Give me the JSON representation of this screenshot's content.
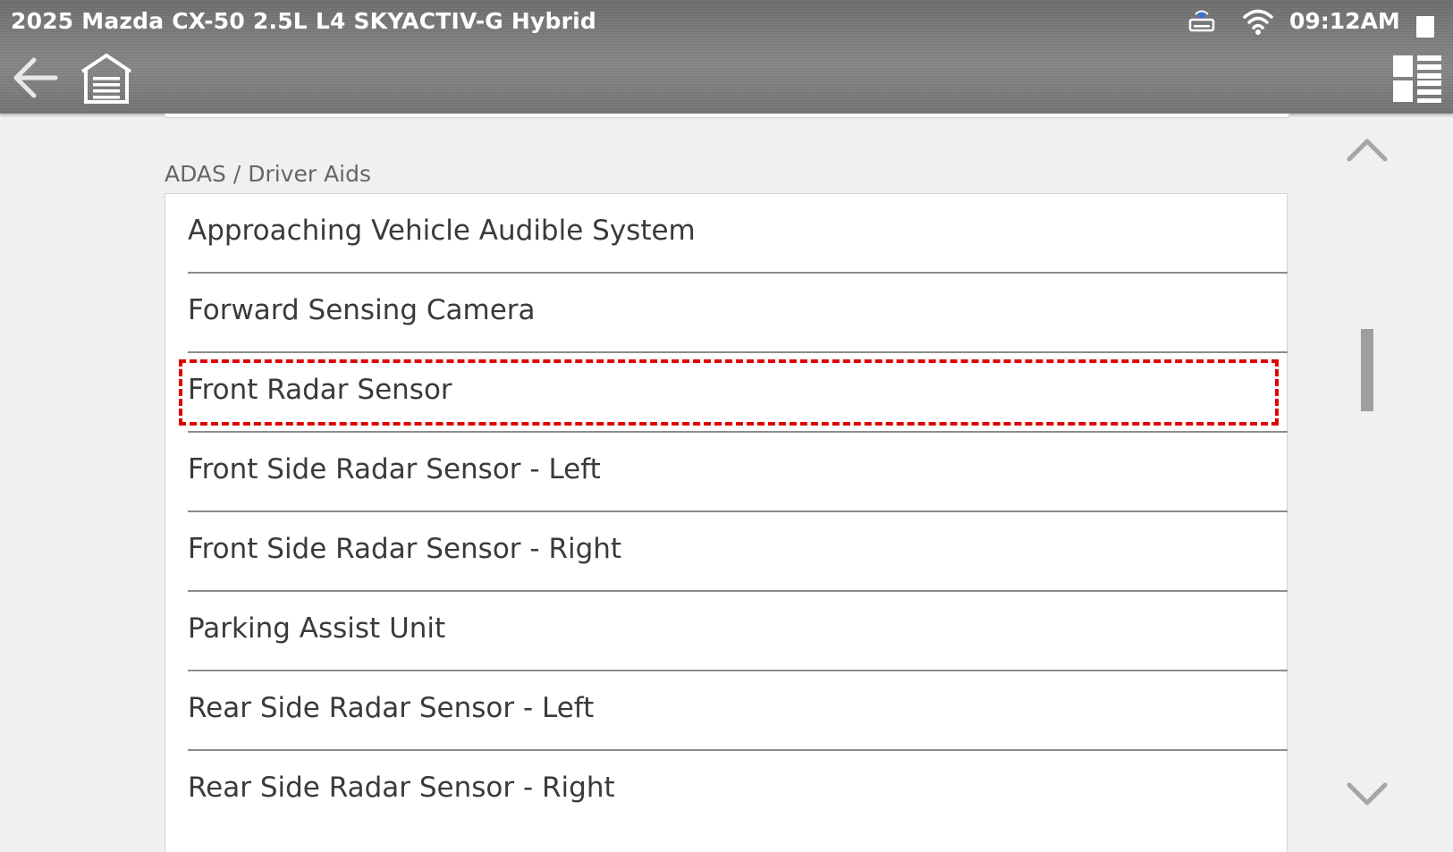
{
  "header": {
    "vehicle_title": "2025 Mazda CX-50 2.5L L4 SKYACTIV-G Hybrid",
    "clock": "09:12AM",
    "icons": {
      "vci": "vehicle-interface-icon",
      "wifi": "wifi-icon",
      "battery": "battery-icon",
      "back": "back-arrow-icon",
      "home": "garage-home-icon",
      "view": "view-toggle-icon"
    }
  },
  "section": {
    "title": "ADAS / Driver Aids",
    "items": [
      {
        "label": "Approaching Vehicle Audible System"
      },
      {
        "label": "Forward Sensing Camera"
      },
      {
        "label": "Front Radar Sensor",
        "highlighted": true
      },
      {
        "label": "Front Side Radar Sensor - Left"
      },
      {
        "label": "Front Side Radar Sensor - Right"
      },
      {
        "label": "Parking Assist Unit"
      },
      {
        "label": "Rear Side Radar Sensor - Left"
      },
      {
        "label": "Rear Side Radar Sensor - Right"
      }
    ]
  },
  "colors": {
    "header_bg": "#7a7a7a",
    "highlight": "#e00000",
    "text": "#3a3a3a",
    "section_title": "#666666"
  }
}
